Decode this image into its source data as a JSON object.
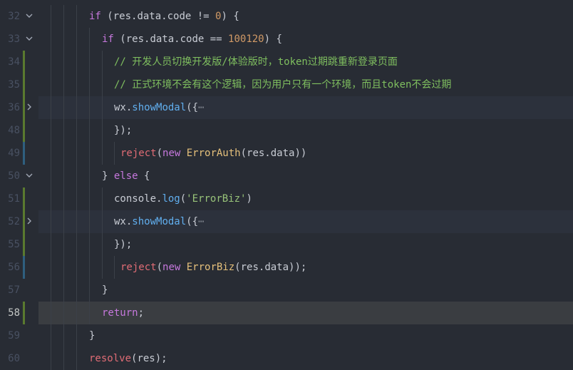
{
  "editor": {
    "theme_colors": {
      "background": "#282c34",
      "keyword": "#c678dd",
      "function": "#61afef",
      "string": "#98c379",
      "comment": "#7fbf5f",
      "number": "#d19a66",
      "class": "#e5c07b"
    },
    "lines": [
      {
        "num": "32",
        "tokens": [
          [
            "if ",
            "kw"
          ],
          [
            "(res.data.code ",
            "plain"
          ],
          [
            "!= ",
            "plain"
          ],
          [
            "0",
            "num"
          ],
          [
            ") ",
            "plain"
          ],
          [
            "{",
            "plain"
          ]
        ]
      },
      {
        "num": "33",
        "tokens": [
          [
            "if ",
            "kw"
          ],
          [
            "(res.data.code ",
            "plain"
          ],
          [
            "== ",
            "plain"
          ],
          [
            "100120",
            "num"
          ],
          [
            ") {",
            "plain"
          ]
        ]
      },
      {
        "num": "34",
        "tokens": [
          [
            "// 开发人员切换开发版/体验版时，token过期跳重新登录页面",
            "cmt"
          ]
        ]
      },
      {
        "num": "35",
        "tokens": [
          [
            "// 正式环境不会有这个逻辑，因为用户只有一个环境，而且token不会过期",
            "cmt"
          ]
        ]
      },
      {
        "num": "36",
        "tokens": [
          [
            "wx.",
            "plain"
          ],
          [
            "showModal",
            "fn"
          ],
          [
            "({",
            "plain"
          ],
          [
            "⋯",
            "ell"
          ]
        ]
      },
      {
        "num": "48",
        "tokens": [
          [
            "});",
            "plain"
          ]
        ]
      },
      {
        "num": "49",
        "tokens": [
          [
            "reject",
            "fnr"
          ],
          [
            "(",
            "plain"
          ],
          [
            "new ",
            "kw"
          ],
          [
            "ErrorAuth",
            "cls"
          ],
          [
            "(res.data))",
            "plain"
          ]
        ]
      },
      {
        "num": "50",
        "tokens": [
          [
            "} ",
            "plain"
          ],
          [
            "else ",
            "kw"
          ],
          [
            "{",
            "plain"
          ]
        ]
      },
      {
        "num": "51",
        "tokens": [
          [
            "console.",
            "plain"
          ],
          [
            "log",
            "fn"
          ],
          [
            "(",
            "plain"
          ],
          [
            "'ErrorBiz'",
            "str"
          ],
          [
            ")",
            "plain"
          ]
        ]
      },
      {
        "num": "52",
        "tokens": [
          [
            "wx.",
            "plain"
          ],
          [
            "showModal",
            "fn"
          ],
          [
            "({",
            "plain"
          ],
          [
            "⋯",
            "ell"
          ]
        ]
      },
      {
        "num": "55",
        "tokens": [
          [
            "});",
            "plain"
          ]
        ]
      },
      {
        "num": "56",
        "tokens": [
          [
            "reject",
            "fnr"
          ],
          [
            "(",
            "plain"
          ],
          [
            "new ",
            "kw"
          ],
          [
            "ErrorBiz",
            "cls"
          ],
          [
            "(res.data));",
            "plain"
          ]
        ]
      },
      {
        "num": "57",
        "tokens": [
          [
            "}",
            "plain"
          ]
        ]
      },
      {
        "num": "58",
        "tokens": [
          [
            "return",
            "kw"
          ],
          [
            ";",
            "plain"
          ]
        ]
      },
      {
        "num": "59",
        "tokens": [
          [
            "}",
            "plain"
          ]
        ]
      },
      {
        "num": "60",
        "tokens": [
          [
            "resolve",
            "fnr"
          ],
          [
            "(res);",
            "plain"
          ]
        ]
      }
    ]
  }
}
